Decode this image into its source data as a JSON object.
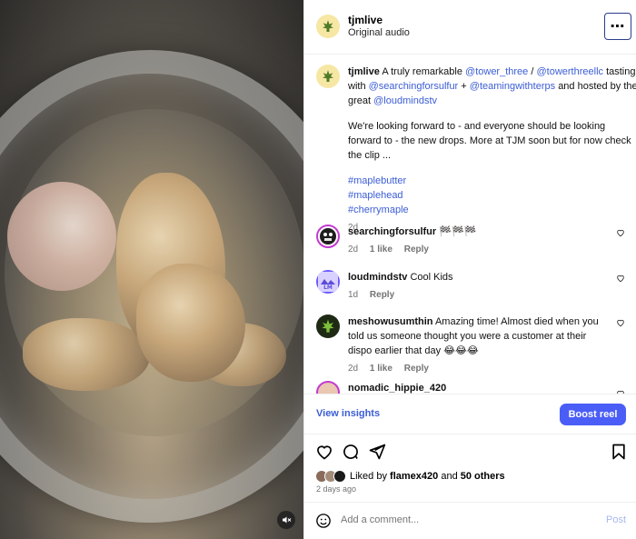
{
  "header": {
    "username": "tjmlive",
    "audio": "Original audio",
    "more_icon": "⋯"
  },
  "caption": {
    "username": "tjmlive",
    "intro": "A truly remarkable",
    "m1": "@tower_three",
    "sep1": "/",
    "m2": "@towerthreellc",
    "mid1": "tasting with",
    "m3": "@searchingforsulfur",
    "plus": "+",
    "m4": "@teamingwithterps",
    "mid2": "and hosted by the great",
    "m5": "@loudmindstv",
    "para2": "We're looking forward to - and everyone should be looking forward to - the new drops. More at TJM soon but for now check the clip ...",
    "tags": [
      "#maplebutter",
      "#maplehead",
      "#cherrymaple"
    ],
    "age": "2d"
  },
  "comments": [
    {
      "username": "searchingforsulfur",
      "text": "🏁🏁🏁",
      "age": "2d",
      "likes": "1 like",
      "reply": "Reply"
    },
    {
      "username": "loudmindstv",
      "text": "Cool Kids",
      "age": "1d",
      "likes": "",
      "reply": "Reply"
    },
    {
      "username": "meshowusumthin",
      "text": "Amazing time! Almost died when you told us someone thought you were a customer at their dispo earlier that day 😂😂😂",
      "age": "2d",
      "likes": "1 like",
      "reply": "Reply"
    },
    {
      "username": "nomadic_hippie_420",
      "text": "",
      "age": "",
      "likes": "",
      "reply": ""
    }
  ],
  "insights": {
    "view": "View insights",
    "boost": "Boost reel"
  },
  "likes": {
    "prefix": "Liked by",
    "user": "flamex420",
    "and": "and",
    "others": "50 others",
    "ago": "2 days ago"
  },
  "composer": {
    "placeholder": "Add a comment...",
    "post": "Post"
  },
  "colors": {
    "link": "#3b5dd6",
    "boost": "#4a5df7",
    "focus_border": "#2a3d8f"
  }
}
